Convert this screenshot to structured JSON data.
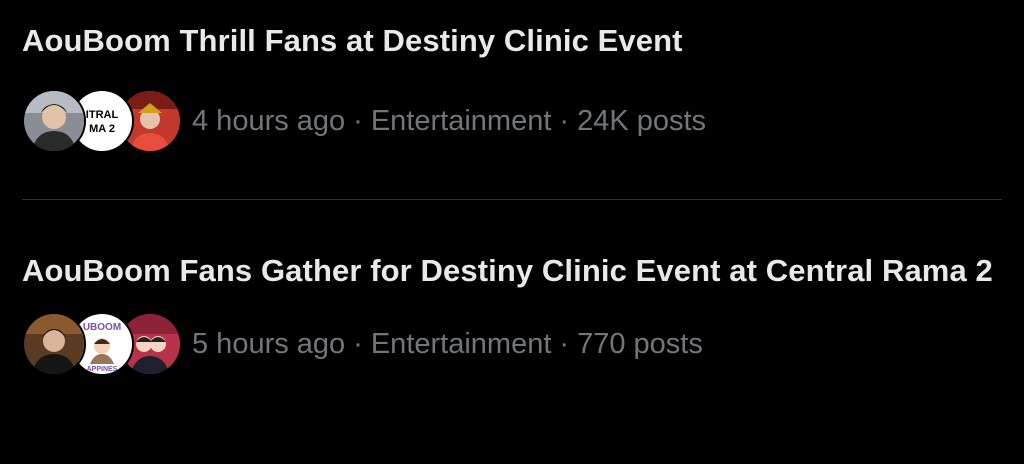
{
  "trends": [
    {
      "title": "AouBoom Thrill Fans at Destiny Clinic Event",
      "time": "4 hours ago",
      "category": "Entertainment",
      "posts": "24K posts",
      "separator": "·",
      "avatars": [
        {
          "icon": "person-photo-avatar",
          "bg": "#8a8d95"
        },
        {
          "icon": "central-rama2-logo-avatar",
          "bg": "#ffffff",
          "text_top": "ITRAL",
          "text_bottom": "MA 2"
        },
        {
          "icon": "costume-photo-avatar",
          "bg": "#c0392b"
        }
      ]
    },
    {
      "title": "AouBoom Fans Gather for Destiny Clinic Event at Central Rama 2",
      "time": "5 hours ago",
      "category": "Entertainment",
      "posts": "770 posts",
      "separator": "·",
      "avatars": [
        {
          "icon": "person-photo-avatar",
          "bg": "#5a3b22"
        },
        {
          "icon": "aouboom-cartoon-avatar",
          "bg": "#ffffff",
          "text_top": "UBOOM",
          "text_bottom": "APPINES"
        },
        {
          "icon": "couple-cartoon-avatar",
          "bg": "#b8324a"
        }
      ]
    }
  ],
  "colors": {
    "background": "#000000",
    "title": "#e7e9ea",
    "meta": "#71767b",
    "divider": "#2f3336"
  }
}
